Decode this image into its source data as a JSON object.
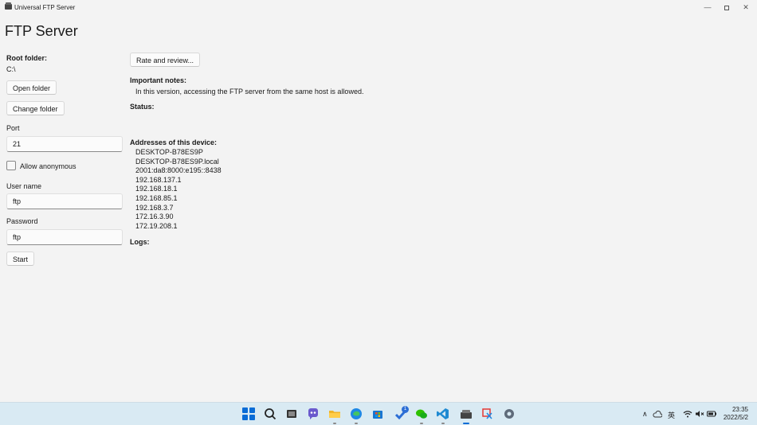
{
  "window": {
    "title": "Universal FTP Server",
    "minimize_glyph": "—",
    "close_glyph": "✕"
  },
  "page": {
    "title": "FTP Server"
  },
  "left": {
    "root_folder_label": "Root folder:",
    "root_folder_value": "C:\\",
    "open_folder_label": "Open folder",
    "change_folder_label": "Change folder",
    "port_label": "Port",
    "port_value": "21",
    "allow_anonymous_label": "Allow anonymous",
    "allow_anonymous_checked": false,
    "username_label": "User name",
    "username_value": "ftp",
    "password_label": "Password",
    "password_value": "ftp",
    "start_label": "Start"
  },
  "right": {
    "rate_label": "Rate and review...",
    "notes_label": "Important notes:",
    "notes_text": "In this version, accessing the FTP server from the same host is allowed.",
    "status_label": "Status:",
    "addresses_label": "Addresses of this device:",
    "addresses": [
      "DESKTOP-B78ES9P",
      "DESKTOP-B78ES9P.local",
      "2001:da8:8000:e195::8438",
      "192.168.137.1",
      "192.168.18.1",
      "192.168.85.1",
      "192.168.3.7",
      "172.16.3.90",
      "172.19.208.1"
    ],
    "logs_label": "Logs:"
  },
  "taskbar": {
    "icons": [
      "windows-start-icon",
      "search-icon",
      "task-view-icon",
      "chat-icon",
      "file-explorer-icon",
      "edge-icon",
      "store-icon",
      "todo-icon",
      "wechat-icon",
      "vscode-icon",
      "ftp-server-icon",
      "snipping-tool-icon",
      "settings-icon"
    ],
    "todo_badge": "1",
    "tray": {
      "chevron": "∧",
      "ime": "英",
      "time": "23:35",
      "date": "2022/5/2"
    },
    "accent": "#0a6cd6"
  }
}
